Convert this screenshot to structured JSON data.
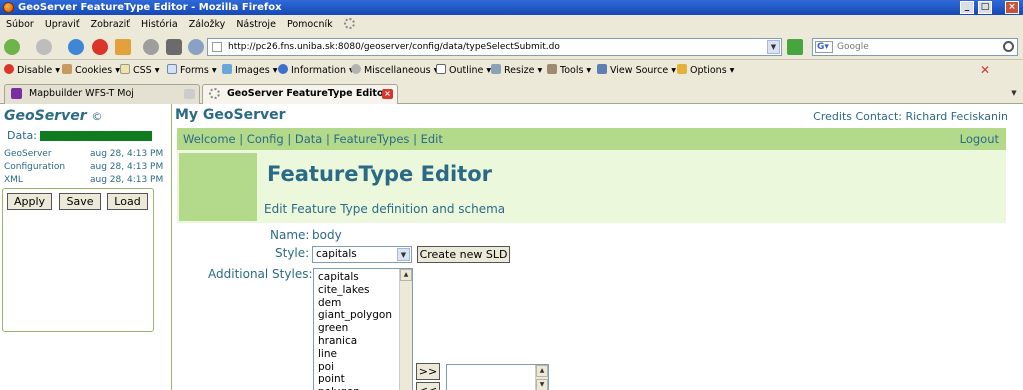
{
  "window": {
    "title": "GeoServer FeatureType Editor - Mozilla Firefox",
    "buttons": [
      "_",
      "□",
      "×"
    ]
  },
  "menu": [
    "Súbor",
    "Upraviť",
    "Zobraziť",
    "História",
    "Záložky",
    "Nástroje",
    "Pomocník"
  ],
  "address": {
    "url": "http://pc26.fns.uniba.sk:8080/geoserver/config/data/typeSelectSubmit.do"
  },
  "search": {
    "placeholder": "Google"
  },
  "webdev": [
    "Disable",
    "Cookies",
    "CSS",
    "Forms",
    "Images",
    "Information",
    "Miscellaneous",
    "Outline",
    "Resize",
    "Tools",
    "View Source",
    "Options"
  ],
  "tabs": [
    {
      "label": "Mapbuilder WFS-T Moj"
    },
    {
      "label": "GeoServer FeatureType Editor"
    }
  ],
  "sidebar": {
    "title": "GeoServer",
    "copyright": "©",
    "data_label": "Data:",
    "status": [
      {
        "name": "GeoServer",
        "time": "aug 28, 4:13 PM"
      },
      {
        "name": "Configuration",
        "time": "aug 28, 4:13 PM"
      },
      {
        "name": "XML",
        "time": "aug 28, 4:13 PM"
      }
    ],
    "apply": "Apply",
    "save": "Save",
    "load": "Load"
  },
  "header": {
    "site": "My GeoServer",
    "credits": "Credits Contact: Richard Feciskanin",
    "nav": [
      "Welcome",
      "Config",
      "Data",
      "FeatureTypes",
      "Edit"
    ],
    "logout": "Logout",
    "page_title": "FeatureType Editor",
    "subtitle": "Edit Feature Type definition and schema"
  },
  "form": {
    "name_label": "Name:",
    "name_value": "body",
    "style_label": "Style:",
    "style_value": "capitals",
    "create_sld": "Create new SLD",
    "additional_label": "Additional Styles:",
    "styles": [
      "capitals",
      "cite_lakes",
      "dem",
      "giant_polygon",
      "green",
      "hranica",
      "line",
      "poi",
      "point",
      "polygon"
    ],
    "add_btn": ">>",
    "remove_btn": "<<"
  },
  "colors": {
    "brand": "#2b6a87",
    "nav_green": "#b3d98a",
    "header_bg": "#ebf8dc",
    "data_bar": "#0e7c1e"
  }
}
